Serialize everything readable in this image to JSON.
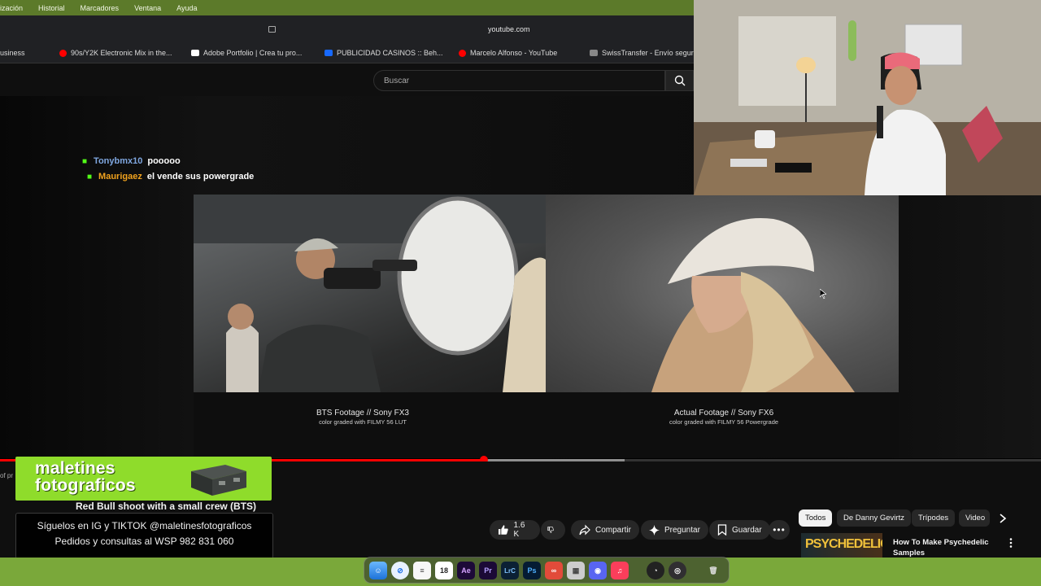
{
  "menubar": {
    "items": [
      "ización",
      "Historial",
      "Marcadores",
      "Ventana",
      "Ayuda"
    ]
  },
  "browser": {
    "url": "youtube.com",
    "bookmarks": [
      {
        "label": "usiness",
        "icon": "none"
      },
      {
        "label": "90s/Y2K Electronic Mix in the...",
        "icon": "youtube-icon"
      },
      {
        "label": "Adobe Portfolio | Crea tu pro...",
        "icon": "adobe-portfolio-icon"
      },
      {
        "label": "PUBLICIDAD CASINOS :: Beh...",
        "icon": "behance-icon"
      },
      {
        "label": "Marcelo Alfonso - YouTube",
        "icon": "youtube-icon"
      },
      {
        "label": "SwissTransfer - Envío seguro",
        "icon": "swisstransfer-icon"
      }
    ]
  },
  "youtube": {
    "search_placeholder": "Buscar"
  },
  "chat": [
    {
      "user": "Tonybmx10",
      "message": "pooooo",
      "color": "#7fa7e0"
    },
    {
      "user": "Maurigaez",
      "message": "el vende sus powergrade",
      "color": "#f0a21e"
    }
  ],
  "video": {
    "left_caption_title": "BTS Footage // Sony FX3",
    "left_caption_sub": "color graded with FILMY 56 LUT",
    "right_caption_title": "Actual Footage // Sony FX6",
    "right_caption_sub": "color graded with FILMY 56 Powergrade",
    "progress_played": 0.465,
    "progress_buffered": 0.6,
    "title": "Red Bull shoot with a small crew (BTS)",
    "partial_text": "of pr"
  },
  "actions": {
    "likes": "1.6 K",
    "share": "Compartir",
    "ask": "Preguntar",
    "save": "Guardar"
  },
  "chips": [
    "Todos",
    "De Danny Gevirtz",
    "Trípodes",
    "Video"
  ],
  "related": {
    "title": "How To Make Psychedelic Samples",
    "thumb_text": "PSYCHEDELIC"
  },
  "brand": {
    "line1": "maletines",
    "line2": "fotograficos",
    "color": "#8fdc2b"
  },
  "promo": {
    "line1": "Síguelos en IG y TIKTOK @maletinesfotograficos",
    "line2": "Pedidos y consultas al WSP 982 831 060"
  },
  "dock": {
    "calendar_day": "18",
    "apps": [
      "finder-icon",
      "safari-icon",
      "notes-icon",
      "calendar-icon",
      "Ae",
      "Pr",
      "LrC",
      "Ps",
      "creative-cloud-icon",
      "archive-utility-icon",
      "discord-icon",
      "music-icon",
      "activity-icon",
      "obs-icon",
      "trash-icon"
    ]
  }
}
